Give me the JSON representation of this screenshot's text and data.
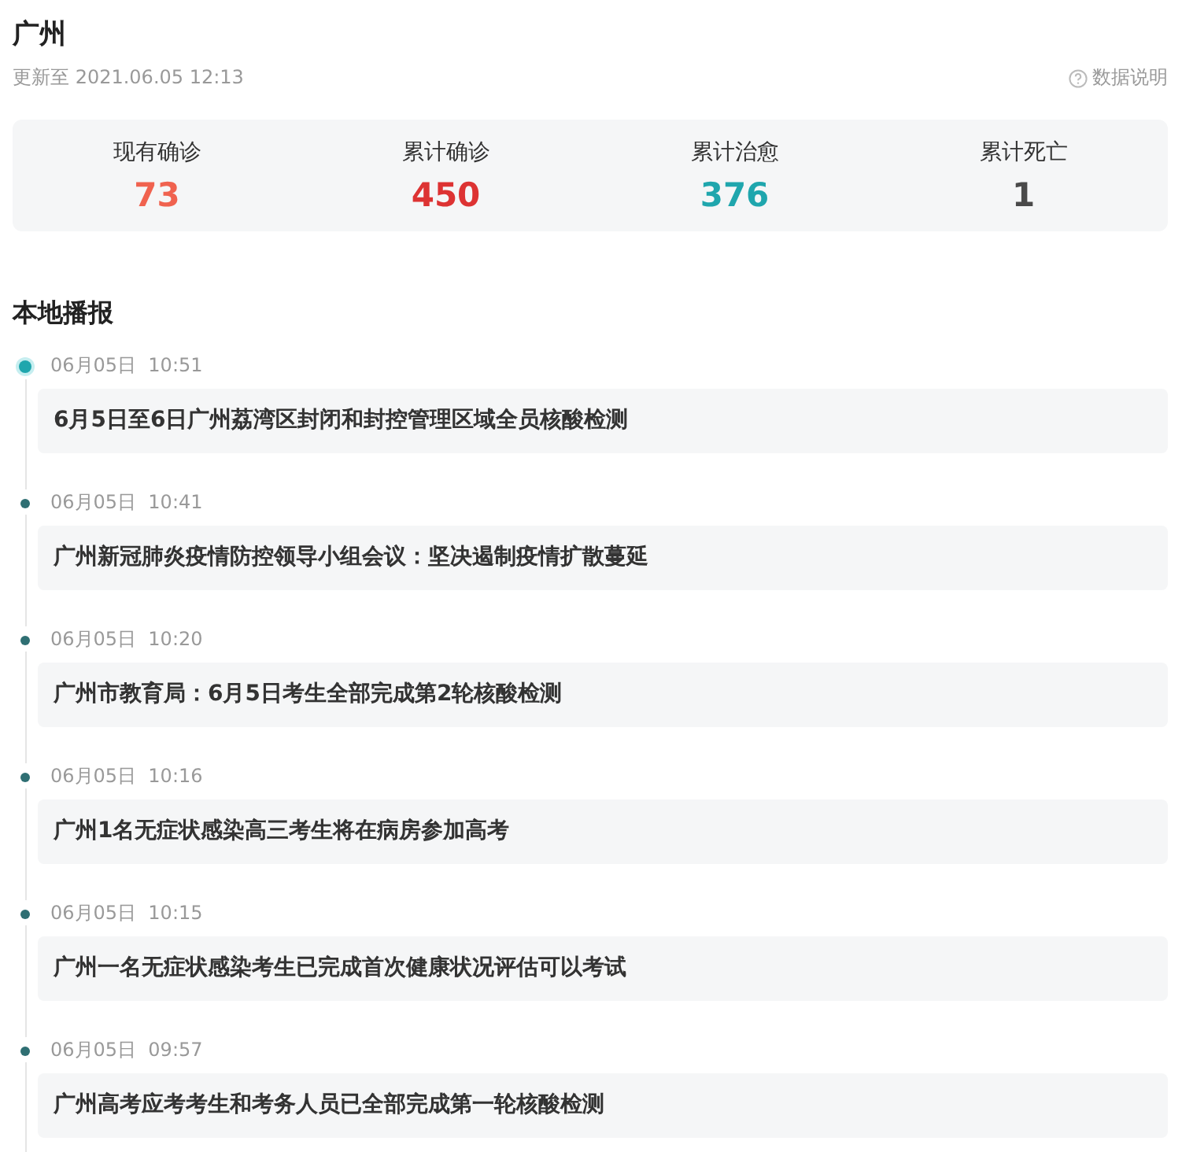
{
  "city": "广州",
  "updated": "更新至 2021.06.05 12:13",
  "data_note": "数据说明",
  "stats": [
    {
      "label": "现有确诊",
      "value": "73",
      "color": "#f0624f"
    },
    {
      "label": "累计确诊",
      "value": "450",
      "color": "#dd3333"
    },
    {
      "label": "累计治愈",
      "value": "376",
      "color": "#1fa6ad"
    },
    {
      "label": "累计死亡",
      "value": "1",
      "color": "#4a4a4a"
    }
  ],
  "section_title": "本地播报",
  "news": [
    {
      "time": "06月05日  10:51",
      "title": "6月5日至6日广州荔湾区封闭和封控管理区域全员核酸检测",
      "selected": true
    },
    {
      "time": "06月05日  10:41",
      "title": "广州新冠肺炎疫情防控领导小组会议：坚决遏制疫情扩散蔓延",
      "selected": false
    },
    {
      "time": "06月05日  10:20",
      "title": "广州市教育局：6月5日考生全部完成第2轮核酸检测",
      "selected": false
    },
    {
      "time": "06月05日  10:16",
      "title": "广州1名无症状感染高三考生将在病房参加高考",
      "selected": false
    },
    {
      "time": "06月05日  10:15",
      "title": "广州一名无症状感染考生已完成首次健康状况评估可以考试",
      "selected": false
    },
    {
      "time": "06月05日  09:57",
      "title": "广州高考应考考生和考务人员已全部完成第一轮核酸检测",
      "selected": false
    }
  ]
}
